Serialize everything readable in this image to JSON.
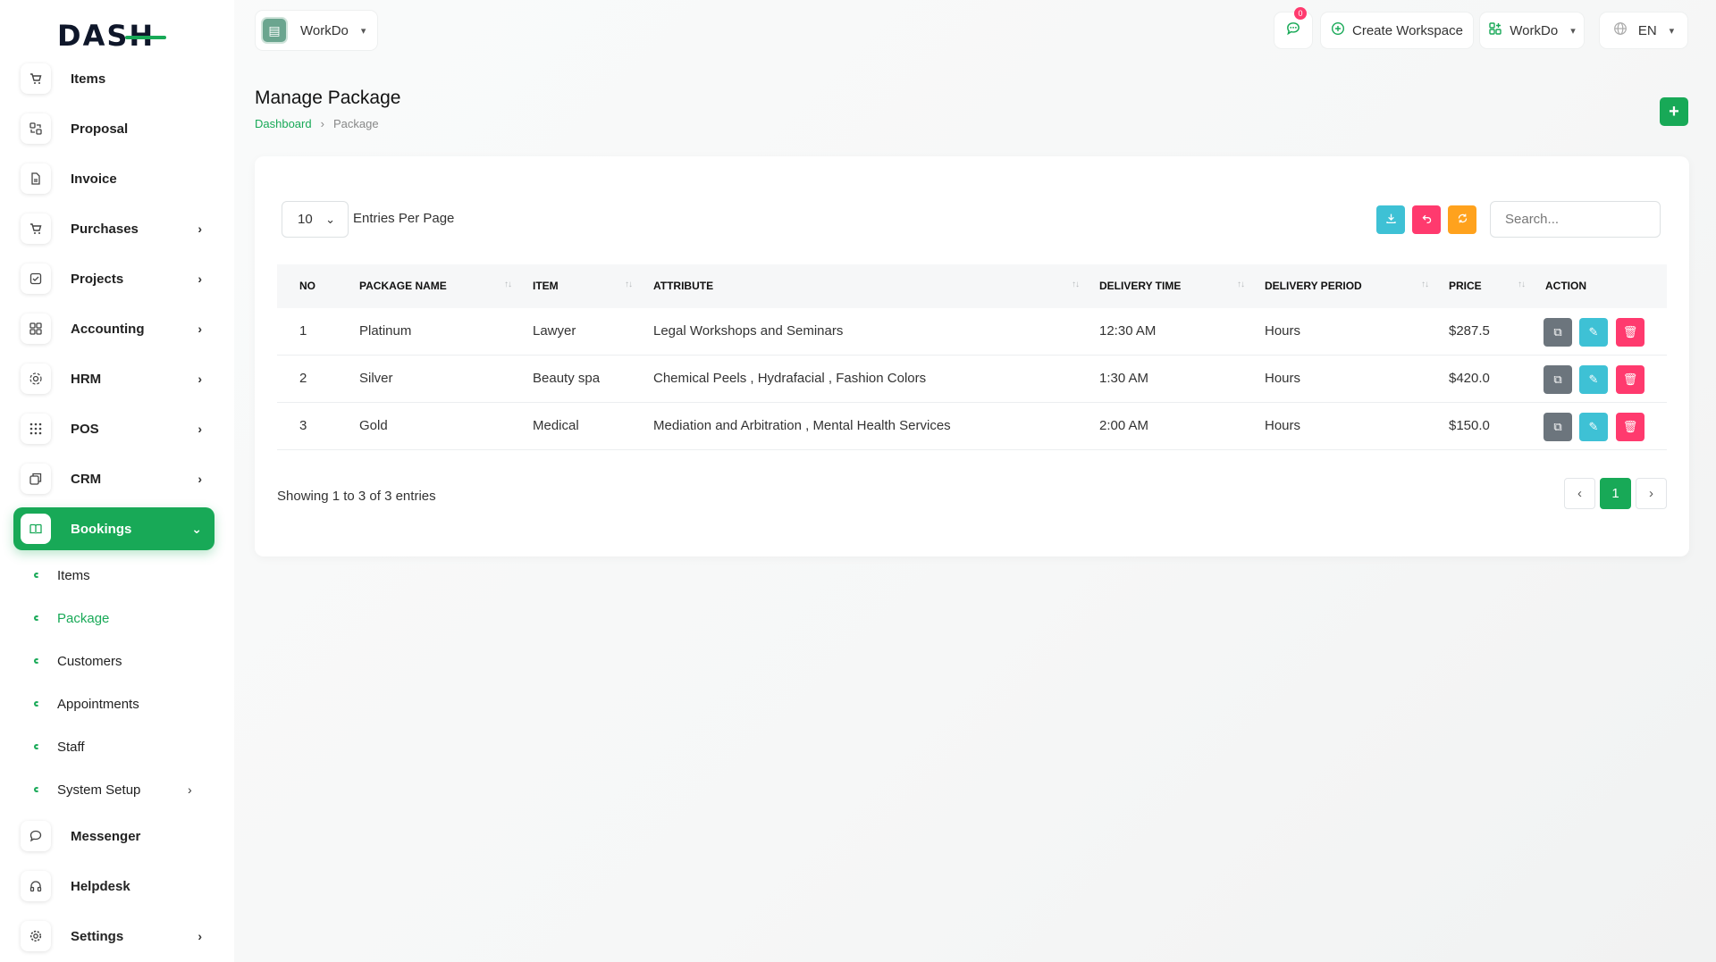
{
  "brand": {
    "logo_text": "DASH"
  },
  "sidebar": {
    "items": [
      {
        "label": "Items",
        "icon": "cart-icon"
      },
      {
        "label": "Proposal",
        "icon": "proposal-icon"
      },
      {
        "label": "Invoice",
        "icon": "file-icon"
      },
      {
        "label": "Purchases",
        "icon": "cart-icon"
      },
      {
        "label": "Projects",
        "icon": "check-square-icon"
      },
      {
        "label": "Accounting",
        "icon": "grid-icon"
      },
      {
        "label": "HRM",
        "icon": "users-icon"
      },
      {
        "label": "POS",
        "icon": "dots-grid-icon"
      },
      {
        "label": "CRM",
        "icon": "layers-icon"
      },
      {
        "label": "Bookings",
        "icon": "book-icon"
      },
      {
        "label": "Messenger",
        "icon": "chat-icon"
      },
      {
        "label": "Helpdesk",
        "icon": "headphones-icon"
      },
      {
        "label": "Settings",
        "icon": "gear-icon"
      }
    ],
    "bookings_sub": [
      {
        "label": "Items"
      },
      {
        "label": "Package"
      },
      {
        "label": "Customers"
      },
      {
        "label": "Appointments"
      },
      {
        "label": "Staff"
      },
      {
        "label": "System Setup"
      }
    ]
  },
  "topbar": {
    "workspace_name": "WorkDo",
    "notification_count": "0",
    "create_workspace": "Create Workspace",
    "workdo_menu": "WorkDo",
    "language": "EN"
  },
  "page": {
    "title": "Manage Package",
    "breadcrumb": {
      "home": "Dashboard",
      "current": "Package"
    }
  },
  "table_controls": {
    "per_page_value": "10",
    "per_page_label": "Entries Per Page",
    "search_placeholder": "Search..."
  },
  "table": {
    "headers": {
      "no": "NO",
      "package_name": "PACKAGE NAME",
      "item": "ITEM",
      "attribute": "ATTRIBUTE",
      "delivery_time": "DELIVERY TIME",
      "delivery_period": "DELIVERY PERIOD",
      "price": "PRICE",
      "action": "ACTION"
    },
    "rows": [
      {
        "no": "1",
        "package_name": "Platinum",
        "item": "Lawyer",
        "attribute": "Legal Workshops and Seminars",
        "delivery_time": "12:30 AM",
        "delivery_period": "Hours",
        "price": "$287.5"
      },
      {
        "no": "2",
        "package_name": "Silver",
        "item": "Beauty spa",
        "attribute": "Chemical Peels , Hydrafacial , Fashion Colors",
        "delivery_time": "1:30 AM",
        "delivery_period": "Hours",
        "price": "$420.0"
      },
      {
        "no": "3",
        "package_name": "Gold",
        "item": "Medical",
        "attribute": "Mediation and Arbitration , Mental Health Services",
        "delivery_time": "2:00 AM",
        "delivery_period": "Hours",
        "price": "$150.0"
      }
    ]
  },
  "footer": {
    "showing": "Showing 1 to 3 of 3 entries",
    "current_page": "1"
  },
  "colors": {
    "accent": "#18a957",
    "info": "#3ec1d5",
    "danger": "#ff3a6e",
    "warning": "#ffa21d",
    "secondary": "#6c757d"
  }
}
